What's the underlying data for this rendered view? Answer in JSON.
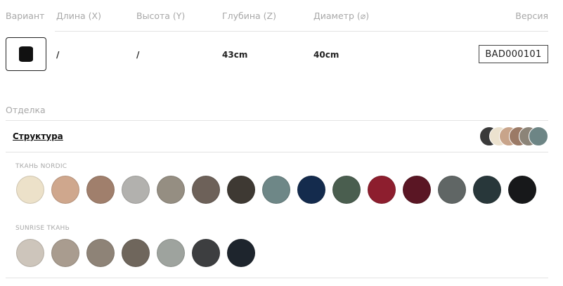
{
  "headers": {
    "variant": "Вариант",
    "length": "Длина (X)",
    "height": "Высота (Y)",
    "depth": "Глубина (Z)",
    "diameter": "Диаметр (⌀)",
    "version": "Версия"
  },
  "row": {
    "length": "/",
    "height": "/",
    "depth": "43cm",
    "diameter": "40cm",
    "version": "BAD000101"
  },
  "finish_label": "Отделка",
  "structure_link": "Структура",
  "structure_preview_colors": [
    "#3a3a3a",
    "#ece2cf",
    "#c8a48a",
    "#9b7a66",
    "#8c8478",
    "#6d8585"
  ],
  "groups": [
    {
      "label": "ТКАНЬ NORDIC",
      "swatches": [
        {
          "name": "cream",
          "color": "#ece1c9"
        },
        {
          "name": "peach",
          "color": "#cfa78d"
        },
        {
          "name": "light-brown",
          "color": "#a07f6c"
        },
        {
          "name": "light-grey",
          "color": "#b2b1ae"
        },
        {
          "name": "taupe",
          "color": "#958e82"
        },
        {
          "name": "brown-grey",
          "color": "#6d6159"
        },
        {
          "name": "dark-brown",
          "color": "#3e3933"
        },
        {
          "name": "teal-grey",
          "color": "#6e8787"
        },
        {
          "name": "navy",
          "color": "#142b4d"
        },
        {
          "name": "forest-green",
          "color": "#4a5e4f"
        },
        {
          "name": "red",
          "color": "#8d1e2e"
        },
        {
          "name": "burgundy",
          "color": "#5a1624"
        },
        {
          "name": "slate",
          "color": "#606665"
        },
        {
          "name": "dark-teal",
          "color": "#28373a"
        },
        {
          "name": "black",
          "color": "#17181a"
        }
      ]
    },
    {
      "label": "SUNRISE ТКАНЬ",
      "swatches": [
        {
          "name": "pale-beige",
          "color": "#cdc5bb"
        },
        {
          "name": "sand",
          "color": "#a99c8f"
        },
        {
          "name": "mushroom",
          "color": "#8e8377"
        },
        {
          "name": "dark-taupe",
          "color": "#6f665c"
        },
        {
          "name": "sage-grey",
          "color": "#9ea39e"
        },
        {
          "name": "charcoal",
          "color": "#3d3e40"
        },
        {
          "name": "midnight",
          "color": "#1e252d"
        }
      ]
    }
  ]
}
